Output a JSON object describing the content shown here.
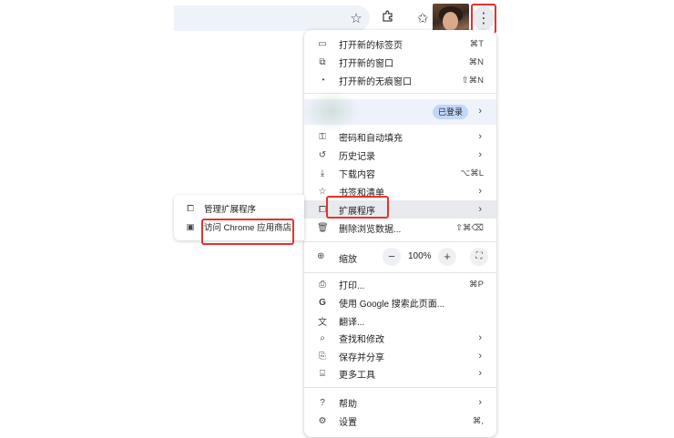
{
  "toolbar": {
    "icons": [
      "star-icon",
      "puzzle-icon",
      "reading-list-icon",
      "avatar",
      "more-vert-icon"
    ],
    "accent_red": "#e5322d"
  },
  "menu": {
    "items_top": [
      {
        "label": "打开新的标签页",
        "shortcut": "⌘T",
        "icon": "new-tab-icon"
      },
      {
        "label": "打开新的窗口",
        "shortcut": "⌘N",
        "icon": "new-window-icon"
      },
      {
        "label": "打开新的无痕窗口",
        "shortcut": "⇧⌘N",
        "icon": "incognito-icon"
      }
    ],
    "profile": {
      "badge": "已登录",
      "chevron": "›"
    },
    "items_mid": [
      {
        "label": "密码和自动填充",
        "chevron": "›",
        "icon": "key-icon"
      },
      {
        "label": "历史记录",
        "chevron": "›",
        "icon": "history-icon"
      },
      {
        "label": "下载内容",
        "shortcut": "⌥⌘L",
        "icon": "download-icon"
      },
      {
        "label": "书签和清单",
        "chevron": "›",
        "icon": "bookmark-star-icon"
      },
      {
        "label": "扩展程序",
        "chevron": "›",
        "icon": "extensions-icon"
      },
      {
        "label": "删除浏览数据...",
        "shortcut": "⇧⌘⌫",
        "icon": "trash-icon"
      }
    ],
    "zoom": {
      "label": "缩放",
      "minus": "−",
      "value": "100%",
      "plus": "+"
    },
    "items_tools": [
      {
        "label": "打印...",
        "shortcut": "⌘P",
        "icon": "print-icon"
      },
      {
        "label": "使用 Google 搜索此页面...",
        "icon": "google-icon"
      },
      {
        "label": "翻译...",
        "icon": "translate-icon"
      },
      {
        "label": "查找和修改",
        "chevron": "›",
        "icon": "find-icon"
      },
      {
        "label": "保存并分享",
        "chevron": "›",
        "icon": "save-share-icon"
      },
      {
        "label": "更多工具",
        "chevron": "›",
        "icon": "toolbox-icon"
      }
    ],
    "items_bottom": [
      {
        "label": "帮助",
        "chevron": "›",
        "icon": "help-icon"
      },
      {
        "label": "设置",
        "shortcut": "⌘,",
        "icon": "gear-icon"
      }
    ]
  },
  "submenu": {
    "items": [
      {
        "label": "管理扩展程序",
        "icon": "puzzle-icon"
      },
      {
        "label": "访问 Chrome 应用商店",
        "icon": "web-store-icon"
      }
    ]
  }
}
